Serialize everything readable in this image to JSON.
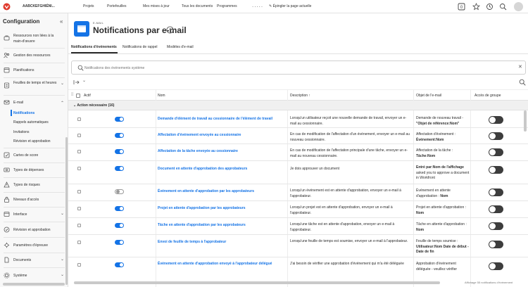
{
  "topnav": {
    "company": "AABCKEFGHIÉNI...",
    "links": [
      "Projets",
      "Portefeuilles",
      "Mes mises à jour",
      "Tous les documents",
      "Programmes"
    ],
    "more": ".....",
    "pin_label": "Épingler la page actuelle",
    "icons": [
      "notifications-icon",
      "star-icon",
      "history-icon",
      "search-icon"
    ]
  },
  "sidebar": {
    "title": "Configuration",
    "items": [
      {
        "label": "Ressources non liées à la main-d'œuvre",
        "icon": "resources-icon",
        "chevron": ""
      },
      {
        "label": "Gestion des ressources",
        "icon": "resource-management-icon",
        "chevron": ""
      },
      {
        "label": "Planifications",
        "icon": "calendar-icon",
        "chevron": ""
      },
      {
        "label": "Feuilles de temps et heures",
        "icon": "timesheet-icon",
        "chevron": "⌄"
      },
      {
        "label": "E-mail",
        "icon": "email-icon",
        "chevron": "⌃"
      },
      {
        "label": "Cartes de score",
        "icon": "scorecard-icon",
        "chevron": ""
      },
      {
        "label": "Types de dépenses",
        "icon": "expense-icon",
        "chevron": ""
      },
      {
        "label": "Types de risques",
        "icon": "risk-icon",
        "chevron": ""
      },
      {
        "label": "Niveaux d'accès",
        "icon": "access-icon",
        "chevron": ""
      },
      {
        "label": "Interface",
        "icon": "interface-icon",
        "chevron": "⌄"
      },
      {
        "label": "Révision et approbation",
        "icon": "review-icon",
        "chevron": ""
      },
      {
        "label": "Paramètres d'épreuve",
        "icon": "proof-settings-icon",
        "chevron": ""
      },
      {
        "label": "Documents",
        "icon": "documents-icon",
        "chevron": "⌄"
      },
      {
        "label": "Système",
        "icon": "system-icon",
        "chevron": "⌄"
      }
    ],
    "email_subitems": [
      "Notifications",
      "Rappels automatiques",
      "Invitations",
      "Révision et approbation"
    ]
  },
  "header": {
    "eyebrow": "E-MAIL",
    "title": "Notifications par e-mail"
  },
  "tabs": [
    "Notifications d'événements",
    "Notifications de rappel",
    "Modèles d'e-mail"
  ],
  "search": {
    "placeholder": "Notifications des événements système"
  },
  "table": {
    "headers": {
      "active": "Actif",
      "name": "Nom",
      "description": "Description ↑",
      "subject": "Objet de l'e-mail",
      "group_access": "Accès de groupe"
    },
    "group_label": "⌄  Action nécessaire (16)",
    "rows": [
      {
        "active": true,
        "name": "Demande d'élément de travail au cessionnaire de l'élément de travail",
        "description": "Lorsqu'un utilisateur reçoit une nouvelle demande de travail, envoyer un e-mail au cessionnaire.",
        "subject_pre": "Demande de nouveau travail - ",
        "subject_bold": "\"Objet de référence:Nom\""
      },
      {
        "active": true,
        "name": "Affectation d'événement envoyée au cessionnaire",
        "description": "En cas de modification de l'affectation d'un événement, envoyer un e-mail au nouveau cessionnaire.",
        "subject_pre": "Affectation d'événement : ",
        "subject_bold": "Événement:Nom"
      },
      {
        "active": true,
        "name": "Affectation de la tâche envoyée au cessionnaire",
        "description": "En cas de modification de l'affectation principale d'une tâche, envoyer un e-mail au nouveau cessionnaire.",
        "subject_pre": "Affectation de la tâche : ",
        "subject_bold": "Tâche:Nom"
      },
      {
        "active": true,
        "name": "Document en attente d'approbation des approbateurs",
        "description": "Je dois approuver un document",
        "subject_pre": "",
        "subject_bold": "Entré par:Nom de l'affichage",
        "subject_post": " asked you to approve a document in Workfront"
      },
      {
        "active": false,
        "name": "Événement en attente d'approbation par les approbateurs",
        "description": "Lorsqu'un événement est en attente d'approbation, envoyer un e-mail à l'approbateur.",
        "subject_pre": "Événement en attente d'approbation : ",
        "subject_bold": "Nom"
      },
      {
        "active": true,
        "name": "Projet en attente d'approbation par les approbateurs",
        "description": "Lorsqu'un projet est en attente d'approbation, envoyer un e-mail à l'approbateur.",
        "subject_pre": "Projet en attente d'approbation : ",
        "subject_bold": "Nom"
      },
      {
        "active": true,
        "name": "Tâche en attente d'approbation par les approbateurs",
        "description": "Lorsqu'une tâche est en attente d'approbation, envoyer un e-mail à l'approbateur.",
        "subject_pre": "Tâche en attente d'approbation : ",
        "subject_bold": "Nom"
      },
      {
        "active": true,
        "name": "Envoi de feuille de temps à l'approbateur",
        "description": "Lorsqu'une feuille de temps est soumise, envoyer un e-mail à l'approbateur.",
        "subject_pre": "Feuille de temps soumise : ",
        "subject_bold": "Utilisateur:Nom Date de début - Date de fin"
      },
      {
        "active": true,
        "name": "Événement en attente d'approbation envoyé à l'approbateur délégué",
        "description": "J'ai besoin de vérifier une approbation d'événement qui m'a été déléguée",
        "subject_pre": "Approbation d'événement déléguée - veuillez vérifier",
        "subject_bold": ""
      }
    ]
  },
  "footer": "Affichage 55 notifications d'événement",
  "colors": {
    "accent": "#1473e6",
    "group_toggle": "#3d3d3d"
  }
}
